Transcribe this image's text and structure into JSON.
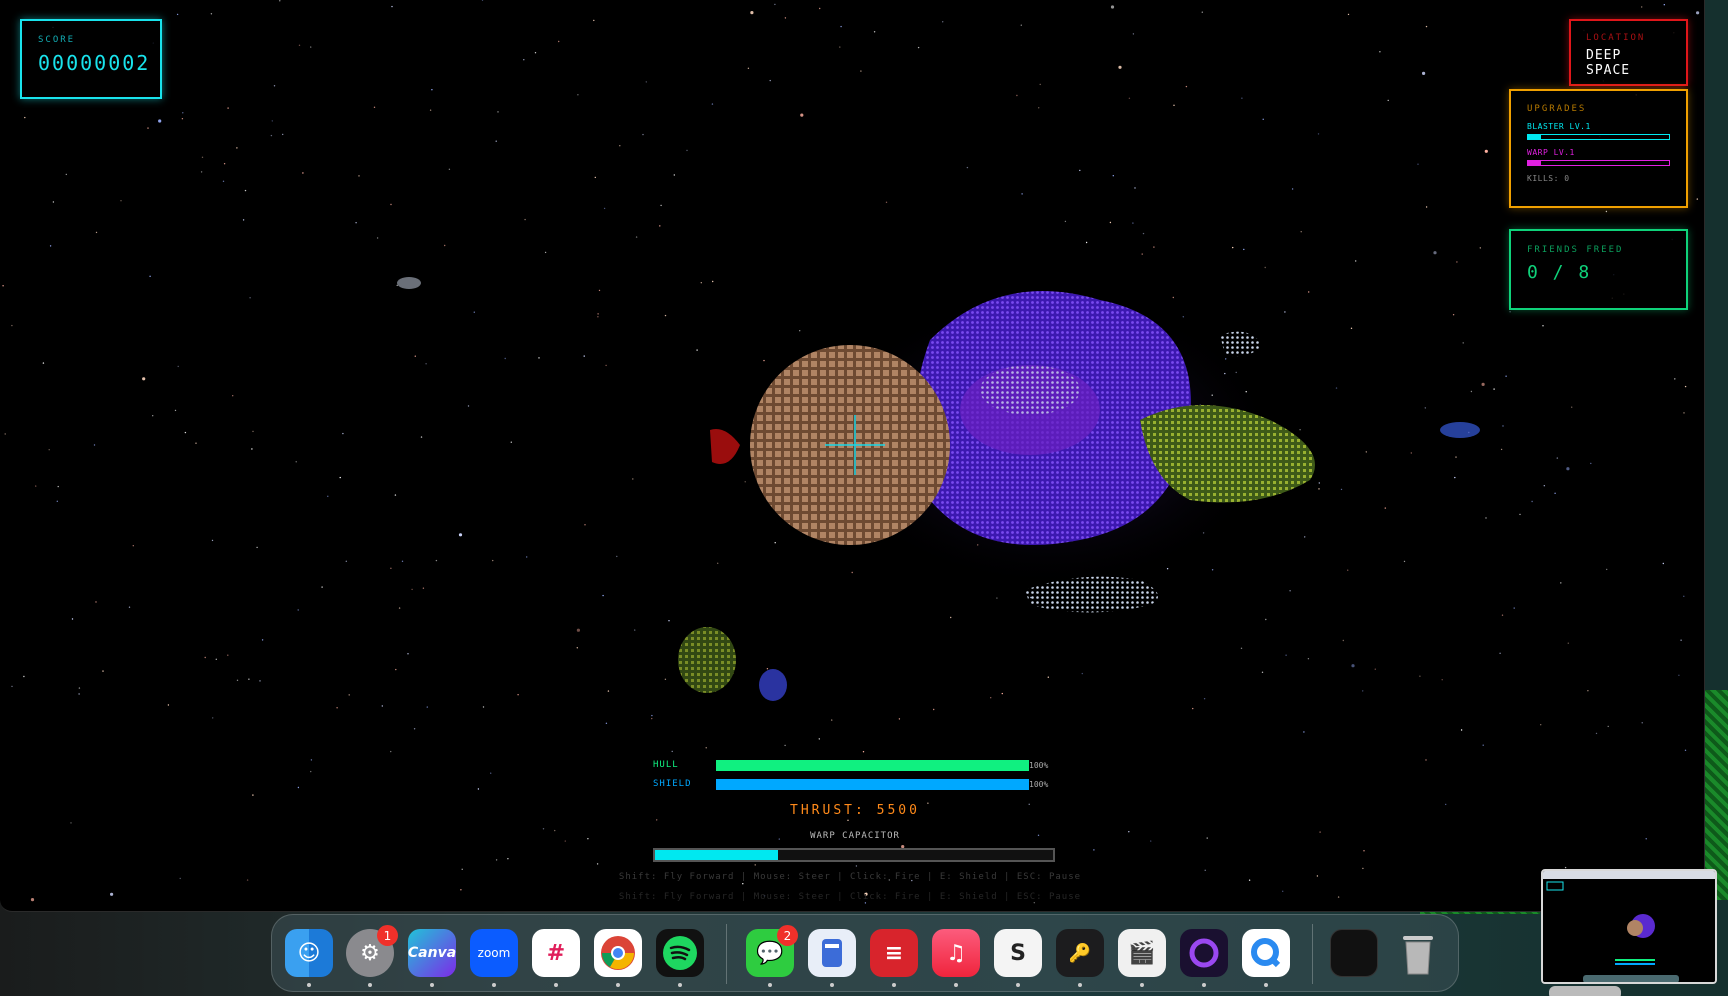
{
  "score": {
    "label": "SCORE",
    "value": "00000002"
  },
  "location": {
    "label": "LOCATION",
    "value": "DEEP SPACE"
  },
  "upgrades": {
    "label": "UPGRADES",
    "items": [
      {
        "name": "BLASTER LV.1",
        "color": "#00e8f0",
        "level": 0.09
      },
      {
        "name": "WARP LV.1",
        "color": "#e020e0",
        "level": 0.09
      }
    ],
    "kills": "KILLS: 0"
  },
  "friends": {
    "label": "FRIENDS FREED",
    "value": "0 / 8"
  },
  "hull": {
    "label": "HULL",
    "pct": "100%",
    "level": 1.0,
    "color": "#10f080"
  },
  "shield": {
    "label": "SHIELD",
    "pct": "100%",
    "level": 1.0,
    "color": "#00a8ff"
  },
  "thrust": "THRUST: 5500",
  "warp": {
    "label": "WARP CAPACITOR",
    "level": 0.31
  },
  "help_text": "Shift: Fly Forward | Mouse: Steer | Click: Fire | E: Shield | ESC: Pause",
  "dock": {
    "apps": [
      {
        "name": "finder",
        "label": ""
      },
      {
        "name": "system-settings",
        "label": "",
        "badge": "1"
      },
      {
        "name": "canva",
        "label": "Canva"
      },
      {
        "name": "zoom",
        "label": "zoom"
      },
      {
        "name": "slack",
        "label": ""
      },
      {
        "name": "chrome",
        "label": ""
      },
      {
        "name": "spotify",
        "label": ""
      },
      {
        "name": "messages",
        "label": "",
        "badge": "2"
      },
      {
        "name": "preview",
        "label": ""
      },
      {
        "name": "expressvpn",
        "label": ""
      },
      {
        "name": "music",
        "label": ""
      },
      {
        "name": "shortcut",
        "label": ""
      },
      {
        "name": "passwords",
        "label": ""
      },
      {
        "name": "claquette",
        "label": ""
      },
      {
        "name": "screen-recorder",
        "label": ""
      },
      {
        "name": "quicktime",
        "label": ""
      }
    ]
  }
}
